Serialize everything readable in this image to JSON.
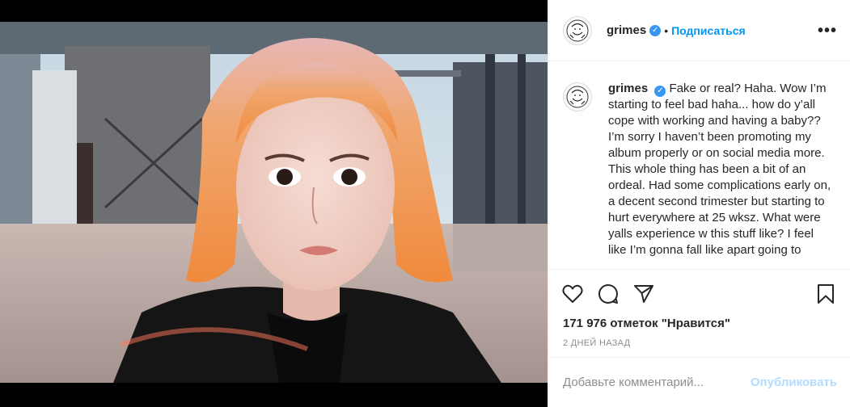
{
  "post": {
    "author": "grimes",
    "verified_mark": "✓",
    "separator": "•",
    "follow_label": "Подписаться",
    "more_label": "•••",
    "caption": "Fake or real? Haha. Wow I’m starting to feel bad haha... how do y’all cope with working and having a baby?? I’m sorry I haven’t been promoting my album properly or on social media more. This whole thing has been a bit of an ordeal. Had some complications early on, a decent second trimester but starting to hurt everywhere at 25 wksz. What were yalls experience w this stuff like? I feel like I’m gonna fall like apart going to",
    "likes": "171 976 отметок \"Нравится\"",
    "time_ago": "2 дней назад"
  },
  "comment_box": {
    "placeholder": "Добавьте комментарий...",
    "publish_label": "Опубликовать"
  },
  "icons": {
    "like": "heart-icon",
    "comment": "comment-icon",
    "share": "share-icon",
    "save": "bookmark-icon",
    "verified": "verified-badge-icon"
  },
  "colors": {
    "link_blue": "#0095f6",
    "verified_blue": "#3897f0",
    "publish_disabled": "#b3dbff",
    "muted": "#8e8e8e"
  }
}
